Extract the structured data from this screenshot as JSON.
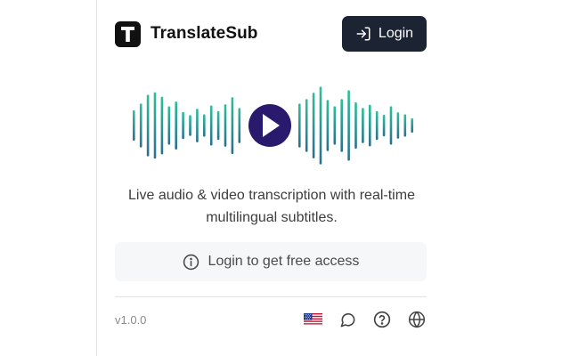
{
  "app": {
    "name": "TranslateSub",
    "logo_letter": "T"
  },
  "header": {
    "login_label": "Login"
  },
  "hero": {
    "play_color": "#2a1a6e",
    "wave_color_top": "#2fbf9a",
    "wave_color_bottom": "#2b6f8e",
    "left_bars": [
      0.38,
      0.55,
      0.77,
      0.83,
      0.72,
      0.48,
      0.6,
      0.34,
      0.26,
      0.42,
      0.28,
      0.5,
      0.36,
      0.53,
      0.71,
      0.44
    ],
    "right_bars": [
      0.55,
      0.66,
      0.82,
      0.97,
      0.64,
      0.48,
      0.66,
      0.88,
      0.58,
      0.44,
      0.52,
      0.36,
      0.27,
      0.48,
      0.33,
      0.28,
      0.18
    ]
  },
  "description": {
    "line1": "Live audio & video transcription with real-time",
    "line2": "multilingual subtitles."
  },
  "access": {
    "label": "Login to get free access",
    "icon": "info-circle-icon"
  },
  "footer": {
    "version": "v1.0.0",
    "icons": [
      "us-flag-icon",
      "chat-bubble-icon",
      "help-circle-icon",
      "globe-icon"
    ]
  },
  "colors": {
    "login_bg": "#1c2433",
    "access_bg": "#f6f7f8"
  }
}
